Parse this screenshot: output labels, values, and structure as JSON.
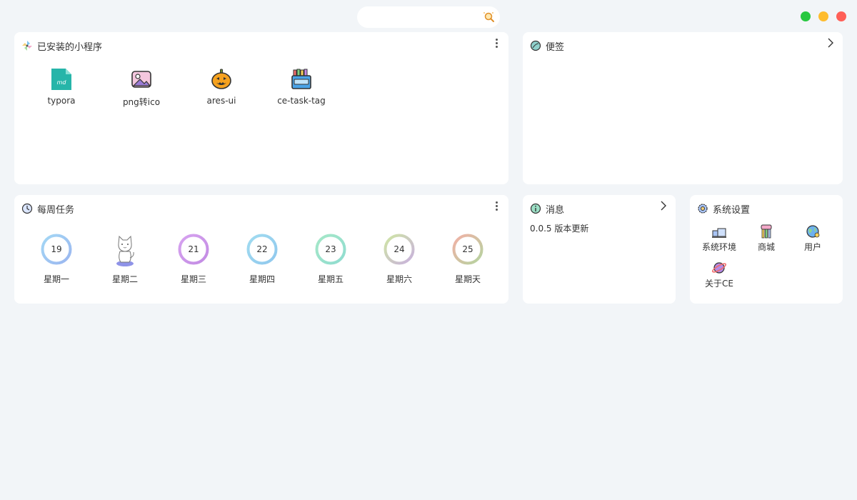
{
  "search": {
    "placeholder": "",
    "value": "",
    "icon": "search-icon"
  },
  "window_controls": {
    "colors": [
      "#28c840",
      "#febc2e",
      "#ff5f57"
    ]
  },
  "installed": {
    "title": "已安装的小程序",
    "apps": [
      {
        "label": "typora",
        "icon": "markdown-file-icon",
        "icon_text": "md"
      },
      {
        "label": "png转ico",
        "icon": "image-icon"
      },
      {
        "label": "ares-ui",
        "icon": "pumpkin-icon"
      },
      {
        "label": "ce-task-tag",
        "icon": "crayon-box-icon"
      }
    ]
  },
  "notes": {
    "title": "便签"
  },
  "weekly": {
    "title": "每周任务",
    "days": [
      {
        "label": "星期一",
        "number": "19"
      },
      {
        "label": "星期二",
        "number": ""
      },
      {
        "label": "星期三",
        "number": "21"
      },
      {
        "label": "星期四",
        "number": "22"
      },
      {
        "label": "星期五",
        "number": "23"
      },
      {
        "label": "星期六",
        "number": "24"
      },
      {
        "label": "星期天",
        "number": "25"
      }
    ],
    "today_icon": "cat-icon"
  },
  "messages": {
    "title": "消息",
    "items": [
      {
        "text": "0.0.5 版本更新"
      }
    ]
  },
  "settings": {
    "title": "系统设置",
    "items": [
      {
        "label": "系统环境",
        "icon": "environment-icon"
      },
      {
        "label": "商城",
        "icon": "shop-icon"
      },
      {
        "label": "用户",
        "icon": "globe-user-icon"
      },
      {
        "label": "关于CE",
        "icon": "planet-icon"
      }
    ]
  }
}
